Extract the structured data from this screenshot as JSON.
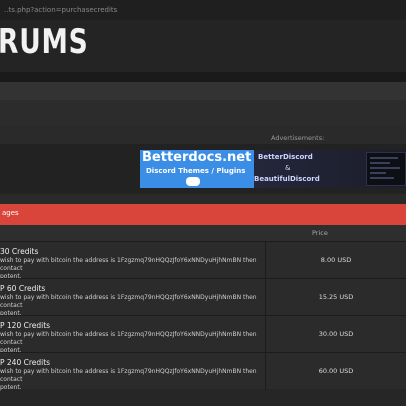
{
  "browser": {
    "url": "..ts.php?action=purchasecredits"
  },
  "header": {
    "logo_text": "RUMS"
  },
  "ads": {
    "label": "Advertisements:",
    "banner": {
      "title": "Betterdocs.net",
      "subtitle": "Discord Themes / Plugins",
      "brand_top": "BetterDiscord",
      "amp": "&",
      "brand_bottom": "BeautifulDiscord"
    }
  },
  "packages": {
    "header": "ages",
    "price_col": "Price",
    "rows": [
      {
        "name": "30 Credits",
        "desc": "wish to pay with bitcoin the address is 1Fzgzmq79nHQQzJfoY6xNNDyuHjhNmBN then contact\npotent.",
        "price": "8.00 USD"
      },
      {
        "name": "P 60 Credits",
        "desc": "wish to pay with bitcoin the address is 1Fzgzmq79nHQQzJfoY6xNNDyuHjhNmBN then contact\npotent.",
        "price": "15.25 USD"
      },
      {
        "name": "P 120 Credits",
        "desc": "wish to pay with bitcoin the address is 1Fzgzmq79nHQQzJfoY6xNNDyuHjhNmBN then contact\npotent.",
        "price": "30.00 USD"
      },
      {
        "name": "P 240 Credits",
        "desc": "wish to pay with bitcoin the address is 1Fzgzmq79nHQQzJfoY6xNNDyuHjhNmBN then contact\npotent.",
        "price": "60.00 USD"
      }
    ]
  }
}
